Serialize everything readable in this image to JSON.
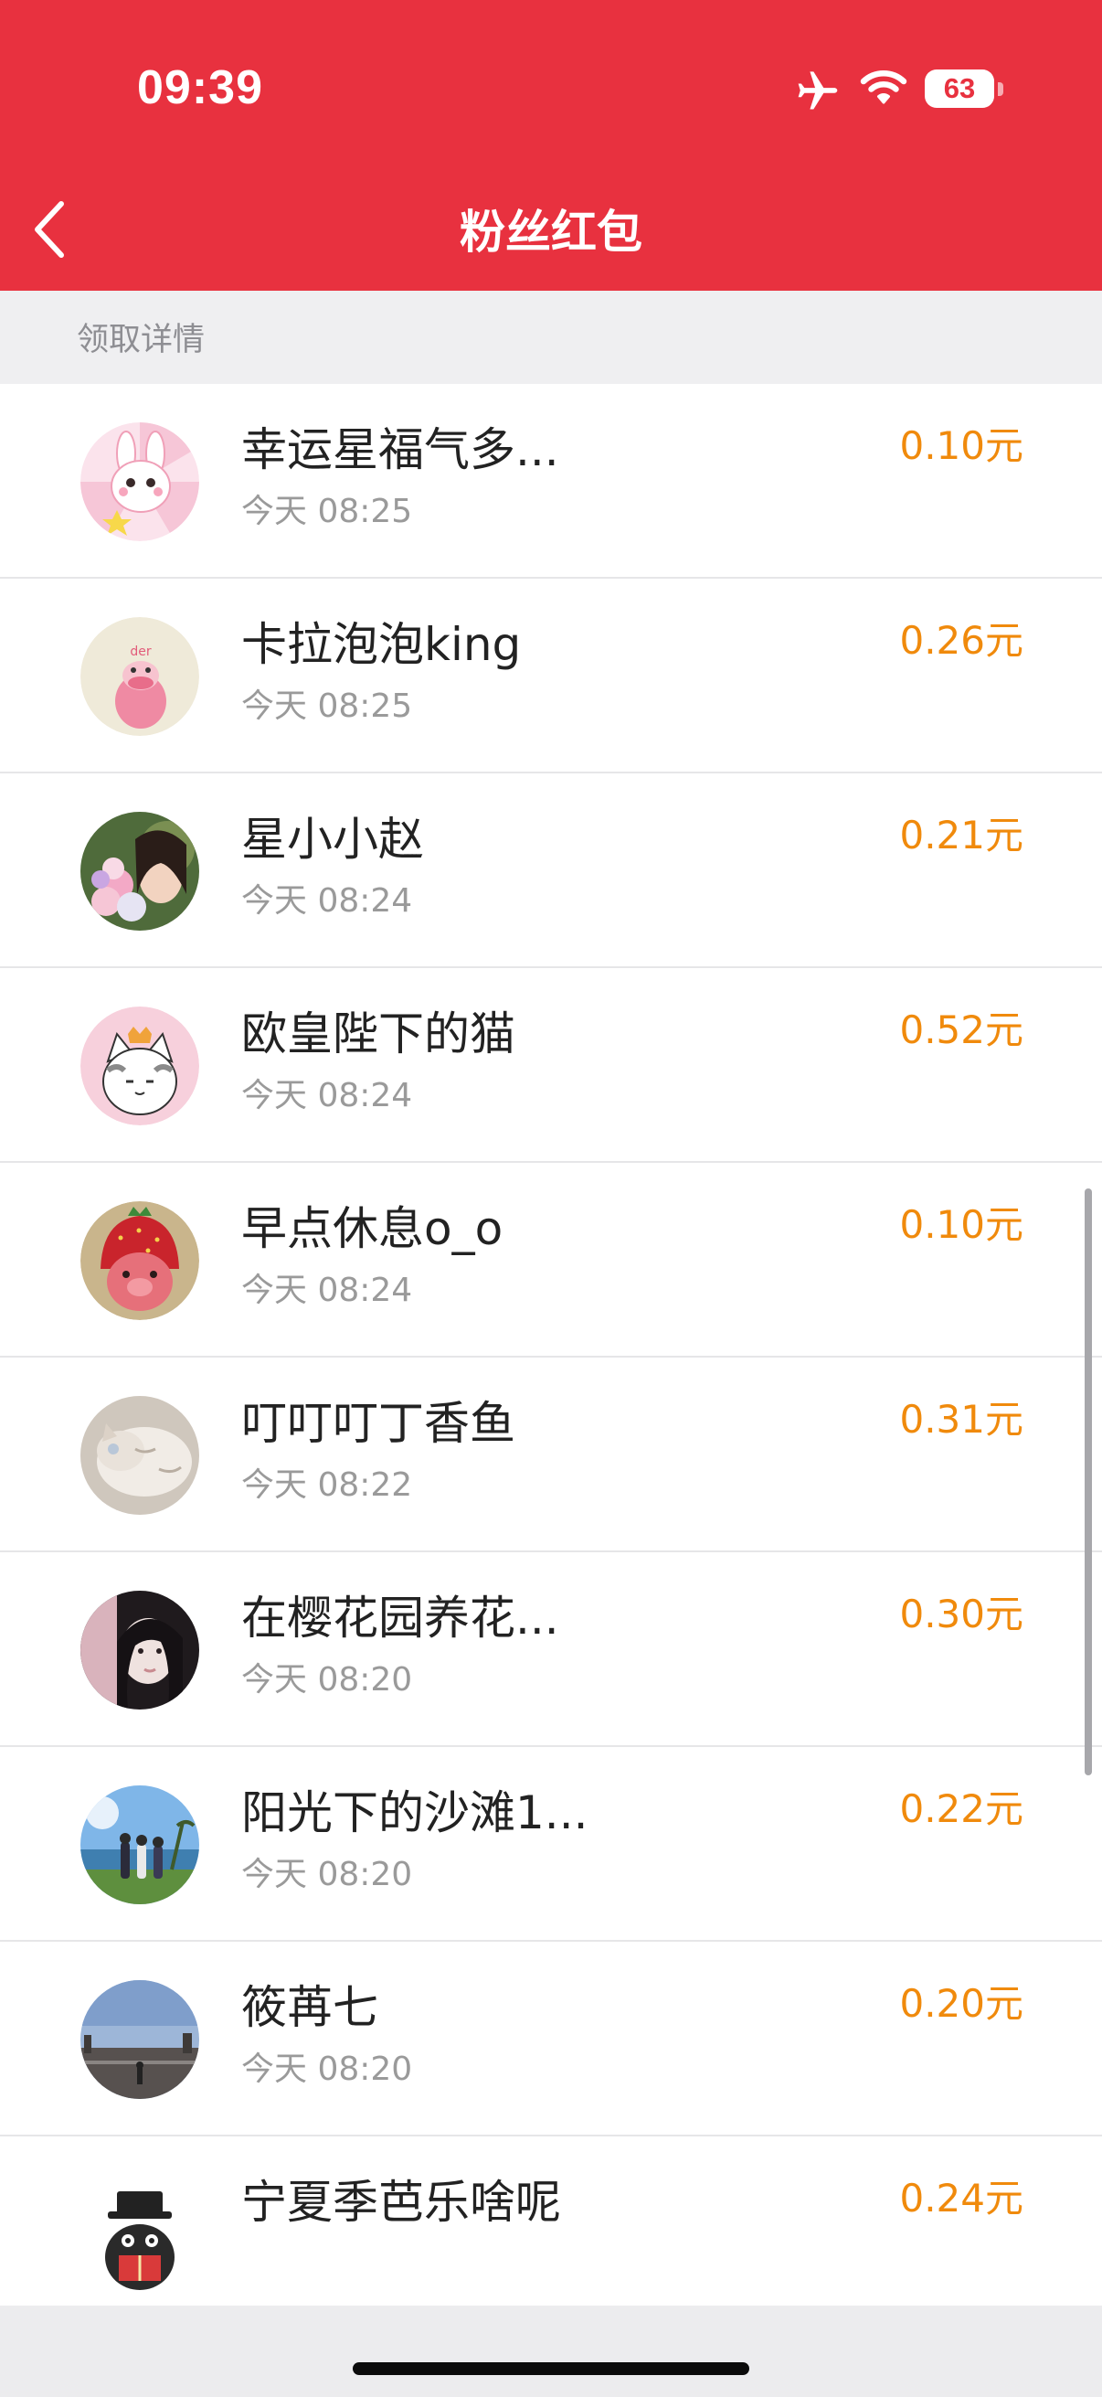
{
  "status_bar": {
    "time": "09:39",
    "battery": "63",
    "battery_level": 0.63,
    "icons": [
      "airplane-icon",
      "wifi-icon",
      "battery-icon"
    ]
  },
  "header": {
    "title": "粉丝红包",
    "back_icon": "chevron-left-icon"
  },
  "colors": {
    "header_bg": "#e8313f",
    "amount": "#f08a0c",
    "name": "#222222",
    "time": "#9a9a9a",
    "section_bg": "#efeff1"
  },
  "section": {
    "label": "领取详情"
  },
  "list": [
    {
      "name": "幸运星福气多...",
      "time": "今天 08:25",
      "amount": "0.10元",
      "avatar": "rabbit-cartoon-avatar"
    },
    {
      "name": "卡拉泡泡king",
      "time": "今天 08:25",
      "amount": "0.26元",
      "avatar": "pink-character-avatar"
    },
    {
      "name": "星小小赵",
      "time": "今天 08:24",
      "amount": "0.21元",
      "avatar": "girl-with-flowers-avatar"
    },
    {
      "name": "欧皇陛下的猫",
      "time": "今天 08:24",
      "amount": "0.52元",
      "avatar": "cartoon-cat-avatar"
    },
    {
      "name": "早点休息o_o",
      "time": "今天 08:24",
      "amount": "0.10元",
      "avatar": "strawberry-hat-avatar"
    },
    {
      "name": "叮叮叮丁香鱼",
      "time": "今天 08:22",
      "amount": "0.31元",
      "avatar": "sleeping-cat-avatar"
    },
    {
      "name": "在樱花园养花...",
      "time": "今天 08:20",
      "amount": "0.30元",
      "avatar": "girl-portrait-avatar"
    },
    {
      "name": "阳光下的沙滩1...",
      "time": "今天 08:20",
      "amount": "0.22元",
      "avatar": "beach-photo-avatar"
    },
    {
      "name": "筱苒七",
      "time": "今天 08:20",
      "amount": "0.20元",
      "avatar": "city-sky-avatar"
    },
    {
      "name": "宁夏季芭乐啥呢",
      "time": "",
      "amount": "0.24元",
      "avatar": "reading-character-avatar"
    }
  ]
}
